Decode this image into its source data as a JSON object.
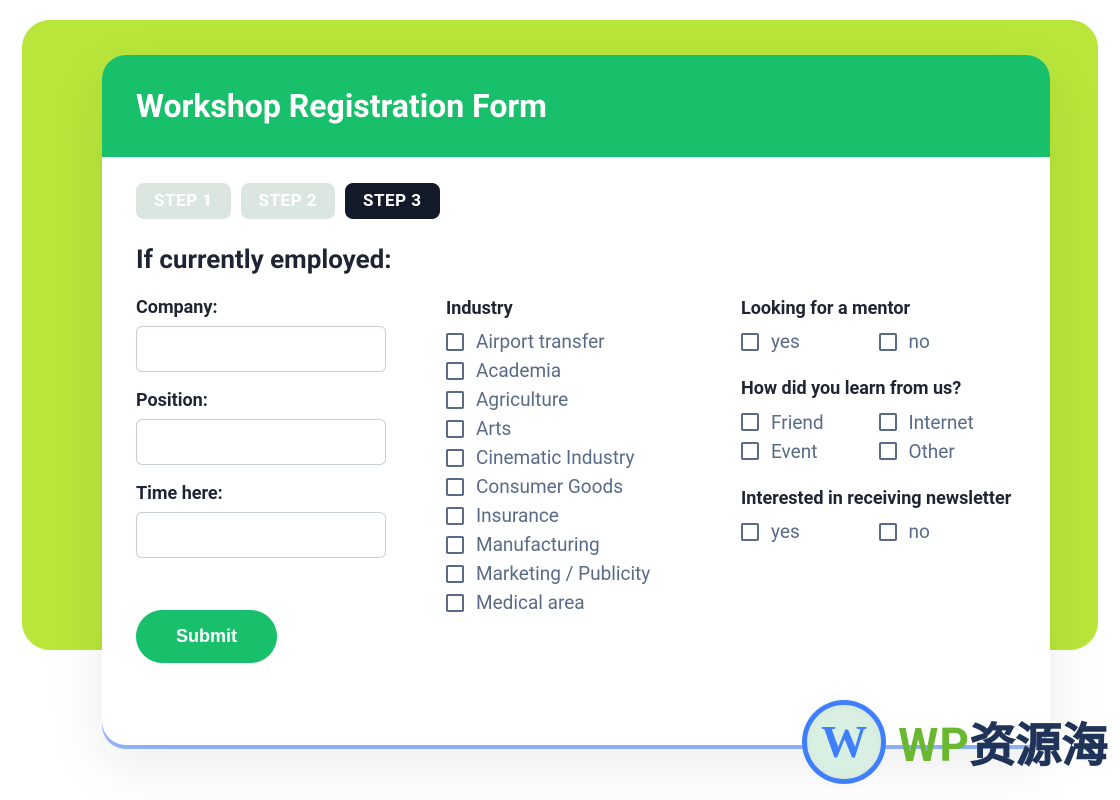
{
  "header": {
    "title": "Workshop Registration Form"
  },
  "steps": [
    {
      "label": "STEP 1",
      "active": false
    },
    {
      "label": "STEP 2",
      "active": false
    },
    {
      "label": "STEP 3",
      "active": true
    }
  ],
  "section_heading": "If currently employed:",
  "left": {
    "company_label": "Company:",
    "position_label": "Position:",
    "time_label": "Time here:",
    "company_value": "",
    "position_value": "",
    "time_value": ""
  },
  "industry": {
    "label": "Industry",
    "options": [
      "Airport transfer",
      "Academia",
      "Agriculture",
      "Arts",
      "Cinematic Industry",
      "Consumer Goods",
      "Insurance",
      "Manufacturing",
      "Marketing / Publicity",
      "Medical area"
    ]
  },
  "mentor": {
    "label": "Looking for a mentor",
    "options": [
      "yes",
      "no"
    ]
  },
  "learn": {
    "label": "How did you learn from us?",
    "options": [
      "Friend",
      "Internet",
      "Event",
      "Other"
    ]
  },
  "newsletter": {
    "label": "Interested in receiving newsletter",
    "options": [
      "yes",
      "no"
    ]
  },
  "submit_label": "Submit",
  "watermark": {
    "prefix": "WP",
    "suffix": "资源海"
  }
}
